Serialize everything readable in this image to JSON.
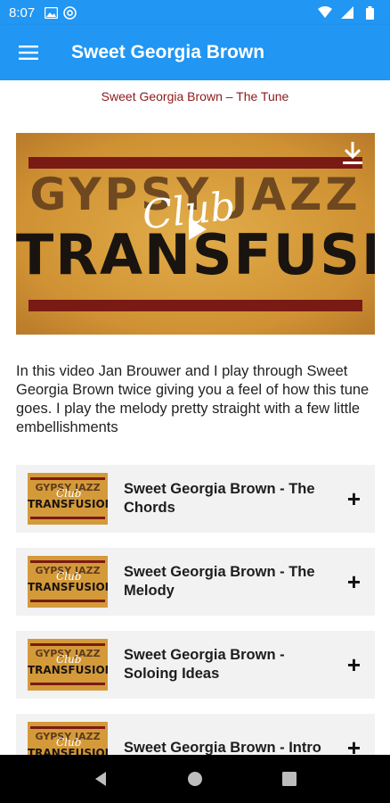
{
  "status_bar": {
    "time": "8:07",
    "left_icons": [
      "image-icon",
      "at-icon"
    ],
    "right_icons": [
      "wifi-icon",
      "signal-icon",
      "battery-icon"
    ]
  },
  "app_bar": {
    "title": "Sweet Georgia Brown",
    "menu_icon": "hamburger-menu-icon",
    "color": "#2196f3"
  },
  "subtitle": "Sweet Georgia Brown – The Tune",
  "video": {
    "logo_line1": "GYPSY JAZZ",
    "logo_line2": "TRANSFUSION",
    "logo_script": "Club",
    "play_icon": "play-icon",
    "download_icon": "download-icon"
  },
  "description": "In this video Jan Brouwer and I play through Sweet Georgia Brown twice giving you a feel of how this tune goes. I play the melody pretty straight with a few little embellishments",
  "lessons": [
    {
      "title": "Sweet Georgia Brown - The Chords",
      "action": "+"
    },
    {
      "title": "Sweet Georgia Brown - The Melody",
      "action": "+"
    },
    {
      "title": "Sweet Georgia Brown - Soloing Ideas",
      "action": "+"
    },
    {
      "title": "Sweet Georgia Brown - Intro",
      "action": "+"
    }
  ],
  "thumb": {
    "line1": "GYPSY JAZZ",
    "line2": "TRANSFUSION",
    "script": "Club"
  },
  "nav_bar": {
    "icons": [
      "back-icon",
      "home-icon",
      "recents-icon"
    ]
  },
  "colors": {
    "accent": "#2196f3",
    "subtitle": "#8b1a1a",
    "card_bg": "#f2f2f2",
    "stripe": "#7a1a14",
    "logo_bg": "#d49a3a"
  }
}
